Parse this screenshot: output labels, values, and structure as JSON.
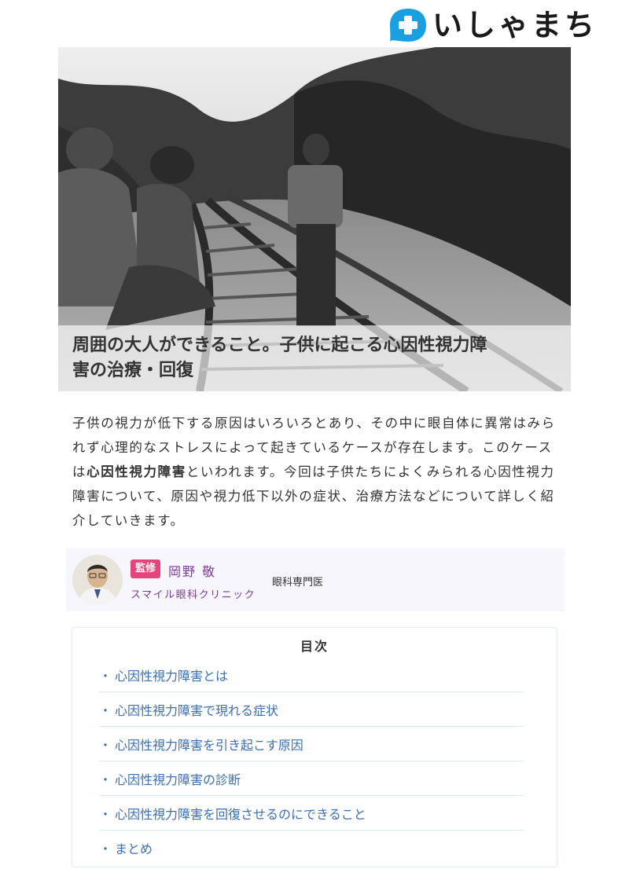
{
  "header": {
    "logo_text": "いしゃまち",
    "logo_icon": "medical-cross-icon",
    "brand_color": "#1aa0e0"
  },
  "hero": {
    "title_line1": "周囲の大人ができること。子供に起こる心因性視力障",
    "title_line2": "害の治療・回復"
  },
  "intro": {
    "part1": "子供の視力が低下する原因はいろいろとあり、その中に眼自体に異常はみられず心理的なストレスによって起きているケースが存在します。このケースは",
    "bold": "心因性視力障害",
    "part2": "といわれます。今回は子供たちによくみられる心因性視力障害について、原因や視力低下以外の症状、治療方法などについて詳しく紹介していきます。"
  },
  "supervisor": {
    "badge": "監修",
    "name": "岡野 敬",
    "clinic": "スマイル眼科クリニック",
    "specialty": "眼科専門医",
    "badge_color": "#e5457a",
    "name_color": "#7d3c98"
  },
  "toc": {
    "title": "目次",
    "bullet": "・",
    "items": [
      "心因性視力障害とは",
      "心因性視力障害で現れる症状",
      "心因性視力障害を引き起こす原因",
      "心因性視力障害の診断",
      "心因性視力障害を回復させるのにできること",
      "まとめ"
    ],
    "link_color": "#3a6fb4"
  }
}
